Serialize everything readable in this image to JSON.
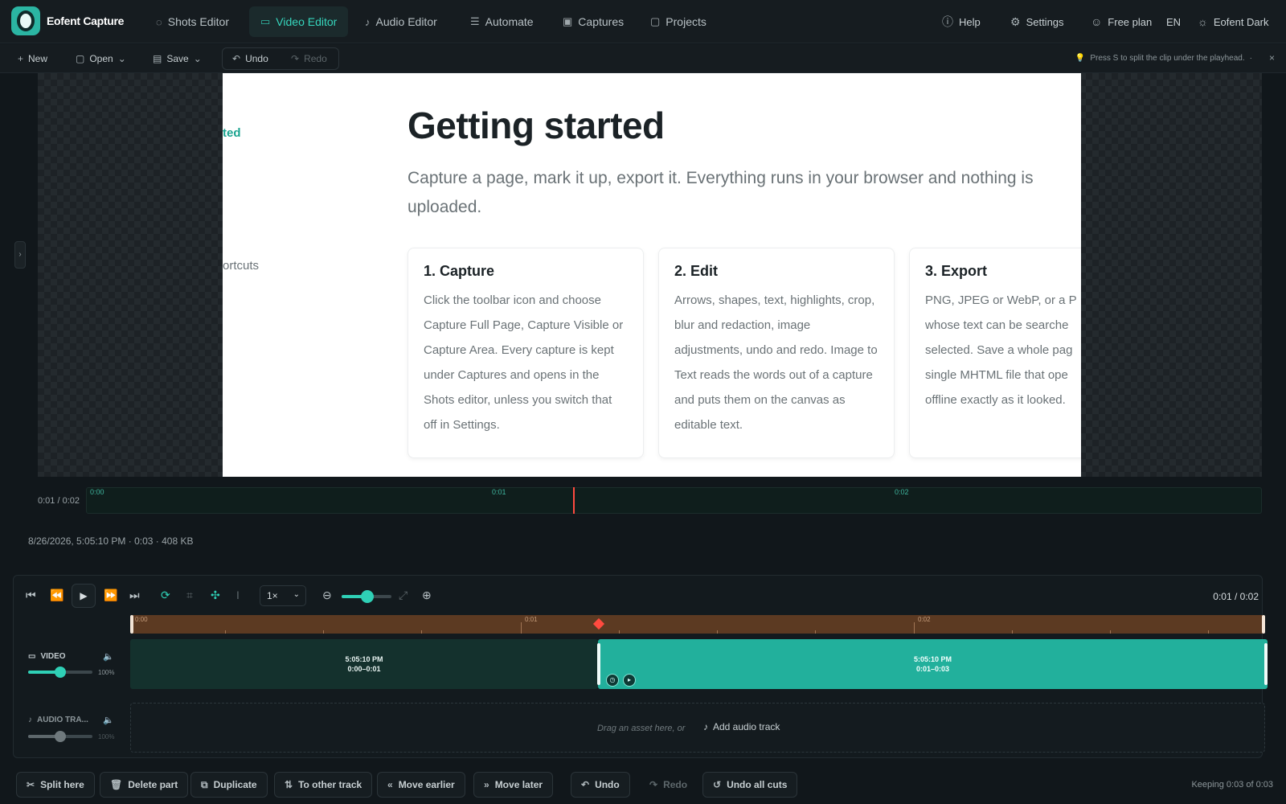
{
  "app": {
    "name": "Eofent Capture"
  },
  "nav": {
    "tabs": [
      {
        "label": "Shots Editor",
        "icon": "shots-icon"
      },
      {
        "label": "Video Editor",
        "icon": "video-icon"
      },
      {
        "label": "Audio Editor",
        "icon": "mic-icon"
      },
      {
        "label": "Automate",
        "icon": "list-icon"
      },
      {
        "label": "Captures",
        "icon": "image-icon"
      },
      {
        "label": "Projects",
        "icon": "folder-icon"
      }
    ],
    "active_tab": "Video Editor",
    "help": "Help",
    "settings": "Settings",
    "plan": "Free plan",
    "lang": "EN",
    "theme": "Eofent Dark"
  },
  "toolbar": {
    "new": "New",
    "open": "Open",
    "save": "Save",
    "undo": "Undo",
    "redo": "Redo",
    "hint": "Press S to split the clip under the playhead.",
    "hint_sep": "·"
  },
  "preview": {
    "side_active": "ted",
    "side_item": "ortcuts",
    "title": "Getting started",
    "lead": "Capture a page, mark it up, export it. Everything runs in your browser and nothing is uploaded.",
    "cards": [
      {
        "title": "1. Capture",
        "body": "Click the toolbar icon and choose Capture Full Page, Capture Visible or Capture Area. Every capture is kept under Captures and opens in the Shots editor, unless you switch that off in Settings."
      },
      {
        "title": "2. Edit",
        "body": "Arrows, shapes, text, highlights, crop, blur and redaction, image adjustments, undo and redo. Image to Text reads the words out of a capture and puts them on the canvas as editable text."
      },
      {
        "title": "3. Export",
        "body": "PNG, JPEG or WebP, or a P whose text can be searche selected. Save a whole pag single MHTML file that ope offline exactly as it looked."
      }
    ]
  },
  "scrubber": {
    "time": "0:01 / 0:02",
    "ticks": [
      "0:00",
      "0:01",
      "0:02"
    ]
  },
  "meta": "8/26/2026, 5:05:10 PM · 0:03 · 408 KB",
  "editor": {
    "speed": "1×",
    "time": "0:01 / 0:02",
    "ruler_ticks": [
      "0:00",
      "0:01",
      "0:02"
    ],
    "tracks": {
      "video": {
        "label": "VIDEO",
        "volume_pct": "100%",
        "volume": 0.5
      },
      "audio": {
        "label": "AUDIO TRA...",
        "volume_pct": "100%",
        "volume": 0.5
      }
    },
    "clips": [
      {
        "title": "5:05:10 PM",
        "range": "0:00–0:01"
      },
      {
        "title": "5:05:10 PM",
        "range": "0:01–0:03"
      }
    ],
    "drag_hint": "Drag an asset here, or",
    "add_audio": "Add audio track",
    "zoom_level": 0.52
  },
  "actions": {
    "split": "Split here",
    "delete": "Delete part",
    "duplicate": "Duplicate",
    "to_other_track": "To other track",
    "move_earlier": "Move earlier",
    "move_later": "Move later",
    "undo": "Undo",
    "redo": "Redo",
    "undo_all": "Undo all cuts",
    "keeping": "Keeping 0:03 of 0:03"
  },
  "colors": {
    "accent": "#2fd0b6",
    "playhead": "#ff4a3f",
    "ruler": "#5c3a22"
  }
}
